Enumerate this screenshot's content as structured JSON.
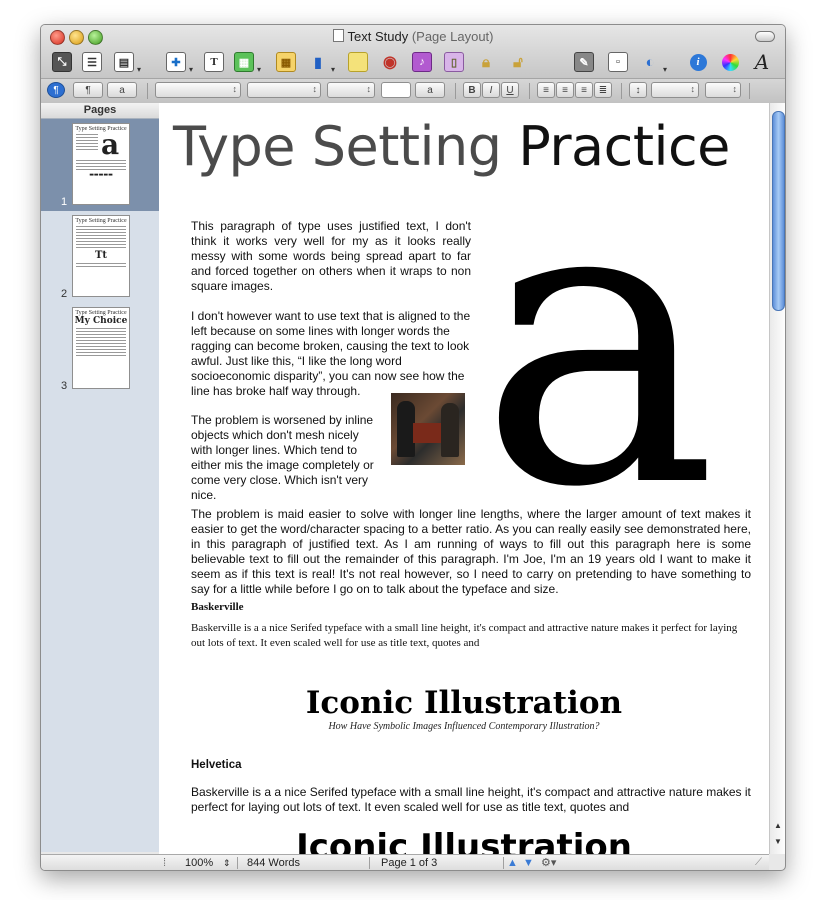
{
  "window": {
    "title": "Text Study",
    "title_suffix": "(Page Layout)"
  },
  "toolbar": {
    "icons": [
      "view-icon",
      "sections-icon",
      "text-box-icon",
      "shapes-icon",
      "table-icon",
      "charts-icon",
      "comment-icon",
      "track-changes-icon",
      "media-icon",
      "lock-icon",
      "unlock-icon",
      "mask-icon",
      "alpha-icon",
      "arrange-icon",
      "inspector-icon",
      "colors-icon",
      "fonts-icon"
    ]
  },
  "formatbar": {
    "paragraph_style": "¶",
    "char_style": "a",
    "font_size_placeholder": "a",
    "bold": "B",
    "italic": "I",
    "underline": "U"
  },
  "sidebar": {
    "header": "Pages",
    "pages": [
      {
        "num": "1",
        "title": "Type Setting Practice",
        "big": "a",
        "selected": true
      },
      {
        "num": "2",
        "title": "Type Setting Practice",
        "big": "Tt",
        "selected": false
      },
      {
        "num": "3",
        "title": "Type Setting Practice",
        "big": "My Choice",
        "selected": false
      }
    ]
  },
  "page": {
    "title_part1": "Type Setting ",
    "title_part2": "Practice",
    "big_letter": "a",
    "p1": "This paragraph of type uses justified text, I don't think it works very well for my as it looks really messy with some words being spread apart to far and forced together on others when it wraps to non square images.",
    "p2": "I don't however want to use text that is aligned to the left because on some lines with longer words the ragging can become broken, causing the text to look awful. Just like this, “I like the long word socioeconomic disparity”, you can now see how the line has broke half way through.",
    "p3": "The problem is worsened by inline objects which don't mesh nicely with longer lines. Which tend to either mis the image completely or come very close. Which isn't very nice.",
    "p4": "The problem is maid easier to solve with longer line lengths, where the larger amount of text makes it easier to get the word/character spacing to a better ratio. As you can really easily see demonstrated here, in this paragraph of justified text. As I am running of ways to fill out this paragraph here is some believable text to fill out the remainder of this paragraph. I'm Joe, I'm an 19 years old I want to make it seem as if this text is real! It's not real however, so I need to carry on pretending to have something to say for a little while before I go on to talk about the typeface and size.",
    "heading_baskerville": "Baskerville",
    "baskerville_text": "Baskerville is a a nice Serifed typeface with a small line height, it's compact and attractive nature makes it perfect for laying out lots of text. It even scaled well for use as title text, quotes and",
    "iconic_title": "Iconic Illustration",
    "iconic_subtitle": "How Have Symbolic Images Influenced Contemporary Illustration?",
    "heading_helvetica": "Helvetica",
    "helvetica_text": "Baskerville is a a nice Serifed typeface with a small line height, it's compact and attractive nature makes it perfect for laying out lots of text. It even scaled well for use as title text, quotes and",
    "iconic_title_2": "Iconic Illustration"
  },
  "statusbar": {
    "zoom": "100%",
    "word_count": "844 Words",
    "page_indicator": "Page 1 of 3"
  }
}
